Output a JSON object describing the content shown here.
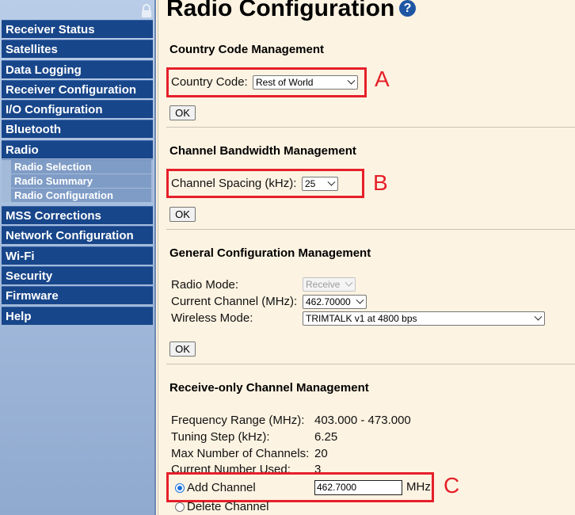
{
  "sidebar": {
    "items": [
      {
        "label": "Receiver Status"
      },
      {
        "label": "Satellites"
      },
      {
        "label": "Data Logging"
      },
      {
        "label": "Receiver Configuration"
      },
      {
        "label": "I/O Configuration"
      },
      {
        "label": "Bluetooth"
      },
      {
        "label": "Radio"
      },
      {
        "label": "MSS Corrections"
      },
      {
        "label": "Network Configuration"
      },
      {
        "label": "Wi-Fi"
      },
      {
        "label": "Security"
      },
      {
        "label": "Firmware"
      },
      {
        "label": "Help"
      }
    ],
    "radio_subitems": [
      {
        "label": "Radio Selection"
      },
      {
        "label": "Radio Summary"
      },
      {
        "label": "Radio Configuration"
      }
    ]
  },
  "page": {
    "title": "Radio Configuration",
    "help_glyph": "?"
  },
  "country": {
    "section_title": "Country Code Management",
    "label": "Country Code:",
    "value": "Rest of World",
    "ok_label": "OK",
    "callout": "A"
  },
  "bandwidth": {
    "section_title": "Channel Bandwidth Management",
    "label": "Channel Spacing (kHz):",
    "value": "25",
    "ok_label": "OK",
    "callout": "B"
  },
  "general": {
    "section_title": "General Configuration Management",
    "radio_mode_label": "Radio Mode:",
    "radio_mode_value": "Receive",
    "current_channel_label": "Current Channel (MHz):",
    "current_channel_value": "462.70000",
    "wireless_mode_label": "Wireless Mode:",
    "wireless_mode_value": "TRIMTALK v1 at 4800 bps",
    "ok_label": "OK"
  },
  "receive_only": {
    "section_title": "Receive-only Channel Management",
    "freq_range_label": "Frequency Range (MHz):",
    "freq_range_value": "403.000 - 473.000",
    "tuning_step_label": "Tuning Step (kHz):",
    "tuning_step_value": "6.25",
    "max_channels_label": "Max Number of Channels:",
    "max_channels_value": "20",
    "current_used_label": "Current Number Used:",
    "current_used_value": "3",
    "add_channel_label": "Add Channel",
    "add_channel_value": "462.7000",
    "unit": "MHz",
    "delete_channel_label": "Delete Channel",
    "callout": "C"
  },
  "colors": {
    "nav_bg": "#18468a",
    "sub_nav_bg": "#7f9cc6",
    "page_bg": "#fdf3e2",
    "annotation_red": "#e5202a"
  }
}
